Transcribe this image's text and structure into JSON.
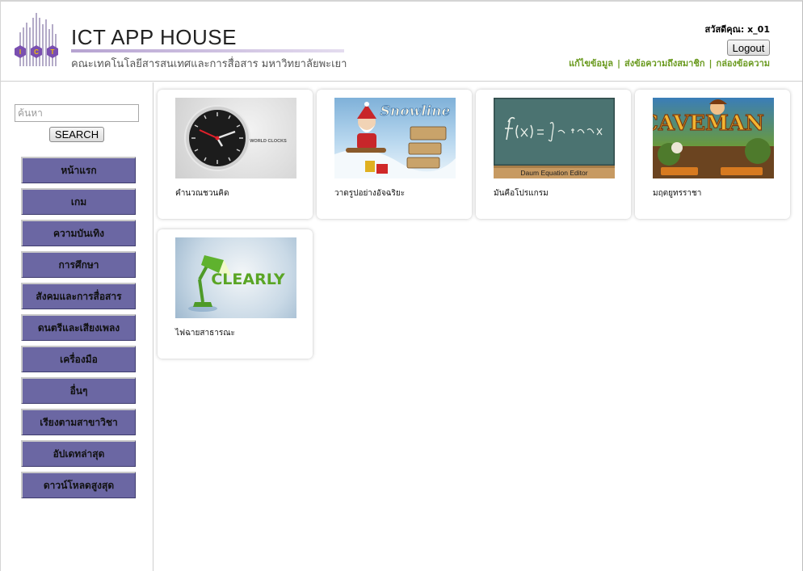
{
  "header": {
    "site_title": "ICT APP HOUSE",
    "site_subtitle": "คณะเทคโนโลยีสารสนเทศและการสื่อสาร มหาวิทยาลัยพะเยา",
    "logo_letters": [
      "I",
      "C",
      "T"
    ],
    "greeting": "สวัสดีคุณ: x_01",
    "logout_label": "Logout",
    "links": [
      "แก้ไขข้อมูล",
      "ส่งข้อความถึงสมาชิก",
      "กล่องข้อความ"
    ],
    "link_separator": "|"
  },
  "sidebar": {
    "search_placeholder": "ค้นหา",
    "search_button": "SEARCH",
    "menu": [
      "หน้าแรก",
      "เกม",
      "ความบันเทิง",
      "การศึกษา",
      "สังคมและการสื่อสาร",
      "ดนตรีและเสียงเพลง",
      "เครื่องมือ",
      "อื่นๆ",
      "เรียงตามสาขาวิชา",
      "อัปเดทล่าสุด",
      "ดาวน์โหลดสูงสุด"
    ]
  },
  "apps": [
    {
      "label": "คำนวณชวนคิด",
      "thumb_icon": "world-clock",
      "thumb_text": "WORLD CLOCKS"
    },
    {
      "label": "วาดรูปอย่างอัจฉริยะ",
      "thumb_icon": "snowline-game",
      "thumb_text": "Snowline"
    },
    {
      "label": "มันคือโปรแกรม",
      "thumb_icon": "equation-editor",
      "thumb_text": "Daum Equation Editor"
    },
    {
      "label": "มฤตยูทรราชา",
      "thumb_icon": "caveman-game",
      "thumb_text": "CAVEMAN"
    },
    {
      "label": "ไฟฉายสาธารณะ",
      "thumb_icon": "evernote-clearly",
      "thumb_text": "CLEARLY"
    }
  ],
  "colors": {
    "menu_bg": "#6b67a3",
    "link_green": "#6a9a1f",
    "logo_purple": "#7a4fb0"
  }
}
